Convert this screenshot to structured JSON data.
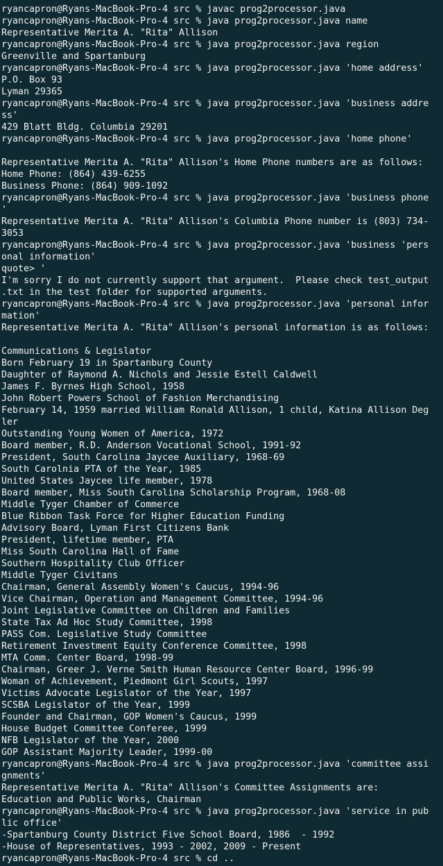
{
  "terminal": {
    "colors": {
      "background": "#0f2a32",
      "text": "#f2f2f2"
    },
    "lines": [
      {
        "type": "prompt",
        "text": "ryancapron@Ryans-MacBook-Pro-4 src % javac prog2processor.java"
      },
      {
        "type": "prompt",
        "text": "ryancapron@Ryans-MacBook-Pro-4 src % java prog2processor.java name"
      },
      {
        "type": "output",
        "text": "Representative Merita A. \"Rita\" Allison"
      },
      {
        "type": "prompt",
        "text": "ryancapron@Ryans-MacBook-Pro-4 src % java prog2processor.java region"
      },
      {
        "type": "output",
        "text": "Greenville and Spartanburg"
      },
      {
        "type": "prompt",
        "text": "ryancapron@Ryans-MacBook-Pro-4 src % java prog2processor.java 'home address'"
      },
      {
        "type": "output",
        "text": "P.O. Box 93"
      },
      {
        "type": "output",
        "text": "Lyman 29365"
      },
      {
        "type": "prompt",
        "text": "ryancapron@Ryans-MacBook-Pro-4 src % java prog2processor.java 'business addre"
      },
      {
        "type": "output",
        "text": "ss'"
      },
      {
        "type": "output",
        "text": "429 Blatt Bldg. Columbia 29201"
      },
      {
        "type": "prompt",
        "text": "ryancapron@Ryans-MacBook-Pro-4 src % java prog2processor.java 'home phone'"
      },
      {
        "type": "output",
        "text": ""
      },
      {
        "type": "output",
        "text": "Representative Merita A. \"Rita\" Allison's Home Phone numbers are as follows:"
      },
      {
        "type": "output",
        "text": "Home Phone: (864) 439-6255"
      },
      {
        "type": "output",
        "text": "Business Phone: (864) 909-1092"
      },
      {
        "type": "prompt",
        "text": "ryancapron@Ryans-MacBook-Pro-4 src % java prog2processor.java 'business phone"
      },
      {
        "type": "output",
        "text": "'"
      },
      {
        "type": "output",
        "text": "Representative Merita A. \"Rita\" Allison's Columbia Phone number is (803) 734-"
      },
      {
        "type": "output",
        "text": "3053"
      },
      {
        "type": "prompt",
        "text": "ryancapron@Ryans-MacBook-Pro-4 src % java prog2processor.java 'business 'pers"
      },
      {
        "type": "output",
        "text": "onal information'"
      },
      {
        "type": "output",
        "text": "quote> '"
      },
      {
        "type": "output",
        "text": "I'm sorry I do not currently support that argument.  Please check test_output"
      },
      {
        "type": "output",
        "text": ".txt in the test folder for supported arguments."
      },
      {
        "type": "prompt",
        "text": "ryancapron@Ryans-MacBook-Pro-4 src % java prog2processor.java 'personal infor"
      },
      {
        "type": "output",
        "text": "mation'"
      },
      {
        "type": "output",
        "text": "Representative Merita A. \"Rita\" Allison's personal information is as follows:"
      },
      {
        "type": "output",
        "text": ""
      },
      {
        "type": "output",
        "text": "Communications & Legislator"
      },
      {
        "type": "output",
        "text": "Born February 19 in Spartanburg County"
      },
      {
        "type": "output",
        "text": "Daughter of Raymond A. Nichols and Jessie Estell Caldwell"
      },
      {
        "type": "output",
        "text": "James F. Byrnes High School, 1958"
      },
      {
        "type": "output",
        "text": "John Robert Powers School of Fashion Merchandising"
      },
      {
        "type": "output",
        "text": "February 14, 1959 married William Ronald Allison, 1 child, Katina Allison Deg"
      },
      {
        "type": "output",
        "text": "ler"
      },
      {
        "type": "output",
        "text": "Outstanding Young Women of America, 1972"
      },
      {
        "type": "output",
        "text": "Board member, R.D. Anderson Vocational School, 1991-92"
      },
      {
        "type": "output",
        "text": "President, South Carolina Jaycee Auxiliary, 1968-69"
      },
      {
        "type": "output",
        "text": "South Carolnia PTA of the Year, 1985"
      },
      {
        "type": "output",
        "text": "United States Jaycee life member, 1978"
      },
      {
        "type": "output",
        "text": "Board member, Miss South Carolina Scholarship Program, 1968-08"
      },
      {
        "type": "output",
        "text": "Middle Tyger Chamber of Commerce"
      },
      {
        "type": "output",
        "text": "Blue Ribbon Task Force for Higher Education Funding"
      },
      {
        "type": "output",
        "text": "Advisory Board, Lyman First Citizens Bank"
      },
      {
        "type": "output",
        "text": "President, lifetime member, PTA"
      },
      {
        "type": "output",
        "text": "Miss South Carolina Hall of Fame"
      },
      {
        "type": "output",
        "text": "Southern Hospitality Club Officer"
      },
      {
        "type": "output",
        "text": "Middle Tyger Civitans"
      },
      {
        "type": "output",
        "text": "Chairman, General Assembly Women's Caucus, 1994-96"
      },
      {
        "type": "output",
        "text": "Vice Chairman, Operation and Management Committee, 1994-96"
      },
      {
        "type": "output",
        "text": "Joint Legislative Committee on Children and Families"
      },
      {
        "type": "output",
        "text": "State Tax Ad Hoc Study Committee, 1998"
      },
      {
        "type": "output",
        "text": "PASS Com. Legislative Study Committee"
      },
      {
        "type": "output",
        "text": "Retirement Investment Equity Conference Committee, 1998"
      },
      {
        "type": "output",
        "text": "MTA Comm. Center Board, 1998-99"
      },
      {
        "type": "output",
        "text": "Chairman, Greer J. Verne Smith Human Resource Center Board, 1996-99"
      },
      {
        "type": "output",
        "text": "Woman of Achievement, Piedmont Girl Scouts, 1997"
      },
      {
        "type": "output",
        "text": "Victims Advocate Legislator of the Year, 1997"
      },
      {
        "type": "output",
        "text": "SCSBA Legislator of the Year, 1999"
      },
      {
        "type": "output",
        "text": "Founder and Chairman, GOP Women's Caucus, 1999"
      },
      {
        "type": "output",
        "text": "House Budget Committee Conferee, 1999"
      },
      {
        "type": "output",
        "text": "NFB Legislator of the Year, 2000"
      },
      {
        "type": "output",
        "text": "GOP Assistant Majority Leader, 1999-00"
      },
      {
        "type": "prompt",
        "text": "ryancapron@Ryans-MacBook-Pro-4 src % java prog2processor.java 'committee assi"
      },
      {
        "type": "output",
        "text": "gnments'"
      },
      {
        "type": "output",
        "text": "Representative Merita A. \"Rita\" Allison's Committee Assignments are:"
      },
      {
        "type": "output",
        "text": "Education and Public Works, Chairman"
      },
      {
        "type": "prompt",
        "text": "ryancapron@Ryans-MacBook-Pro-4 src % java prog2processor.java 'service in pub"
      },
      {
        "type": "output",
        "text": "lic office'"
      },
      {
        "type": "output",
        "text": "-Spartanburg County District Five School Board, 1986  - 1992"
      },
      {
        "type": "output",
        "text": "-House of Representatives, 1993 - 2002, 2009 - Present"
      },
      {
        "type": "prompt",
        "text": "ryancapron@Ryans-MacBook-Pro-4 src % cd .."
      }
    ]
  }
}
